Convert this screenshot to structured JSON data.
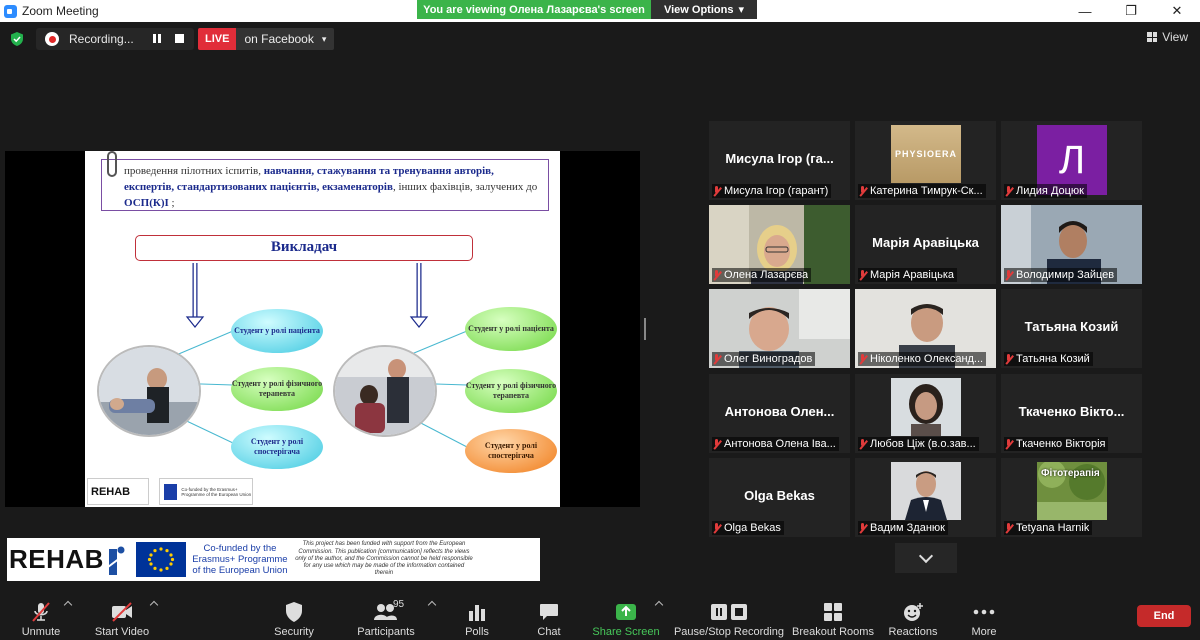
{
  "window": {
    "title": "Zoom Meeting",
    "minimize": "—",
    "restore": "❐",
    "close": "✕"
  },
  "banner": {
    "viewing": "You are viewing Олена Лазарєва's screen",
    "view_options": "View Options",
    "view_options_caret": "▾"
  },
  "topbar": {
    "recording_label": "Recording...",
    "live_badge": "LIVE",
    "live_destination": "on Facebook",
    "live_caret": "▾",
    "view_label": "View"
  },
  "slide": {
    "text_plain_1": "проведення пілотних іспитів, ",
    "text_bold_1": "навчання, стажування та тренування авторів, експертів, стандартизованих пацієнтів, екзаменаторів",
    "text_plain_2": ", інших фахівців, залучених до ",
    "text_bold_2": "ОСП(К)І",
    "text_plain_3": " ;",
    "teacher_title": "Викладач",
    "left_bubbles": [
      "Студент у ролі пацієнта",
      "Студент у ролі фізичного терапевта",
      "Студент у ролі спостерігача"
    ],
    "right_bubbles": [
      "Студент у ролі пацієнта",
      "Студент у ролі фізичного терапевта",
      "Студент у ролі спостерігача"
    ],
    "footer_logo": "REHAB",
    "footer_cofund": "Co-funded by the Erasmus+ Programme of the European Union"
  },
  "logo_banner": {
    "rehab": "REHAB",
    "cofund_line1": "Co-funded by the",
    "cofund_line2": "Erasmus+ Programme",
    "cofund_line3": "of the European Union",
    "disclaimer": "This project has been funded with support from the European Commission. This publication [communication] reflects the views only of the author, and the Commission cannot be held responsible for any use which may be made of the information contained therein"
  },
  "participants": [
    {
      "big": "Мисула Ігор (га...",
      "caption": "Мисула Ігор (гарант)",
      "type": "name"
    },
    {
      "big": "",
      "caption": "Катерина Тимрук-Ск...",
      "type": "physioera",
      "logo_text": "PHYSIOERA"
    },
    {
      "big": "",
      "caption": "Лидия Доцюк",
      "type": "letter",
      "letter": "Л"
    },
    {
      "big": "",
      "caption": "Олена Лазарєва",
      "type": "video-blonde"
    },
    {
      "big": "Марія Аравіцька",
      "caption": "Марія Аравіцька",
      "type": "name"
    },
    {
      "big": "",
      "caption": "Володимир Зайцев",
      "type": "video-man"
    },
    {
      "big": "",
      "caption": "Олег Виноградов",
      "type": "video-man2"
    },
    {
      "big": "",
      "caption": "Ніколенко Олександ...",
      "type": "video-man3"
    },
    {
      "big": "Татьяна Козий",
      "caption": "Татьяна Козий",
      "type": "name"
    },
    {
      "big": "Антонова Олен...",
      "caption": "Антонова Олена Іва...",
      "type": "name"
    },
    {
      "big": "",
      "caption": "Любов Ціж (в.о.зав...",
      "type": "photo-woman"
    },
    {
      "big": "Ткаченко Вікто...",
      "caption": "Ткаченко Вікторія",
      "type": "name"
    },
    {
      "big": "Olga Bekas",
      "caption": "Olga Bekas",
      "type": "name"
    },
    {
      "big": "",
      "caption": "Вадим Зданюк",
      "type": "photo-suit"
    },
    {
      "big": "",
      "caption": "Tetyana Harnik",
      "type": "photo-nature",
      "overlay": "Фітотерапія"
    }
  ],
  "toolbar": {
    "unmute": "Unmute",
    "start_video": "Start Video",
    "security": "Security",
    "participants": "Participants",
    "participants_count": "95",
    "polls": "Polls",
    "chat": "Chat",
    "share_screen": "Share Screen",
    "pause_stop_recording": "Pause/Stop Recording",
    "breakout_rooms": "Breakout Rooms",
    "reactions": "Reactions",
    "more": "More",
    "end": "End"
  },
  "colors": {
    "accent_green": "#3bb44a",
    "live_red": "#e12d39",
    "end_red": "#c52a2a",
    "active_speaker": "#d7f240"
  }
}
